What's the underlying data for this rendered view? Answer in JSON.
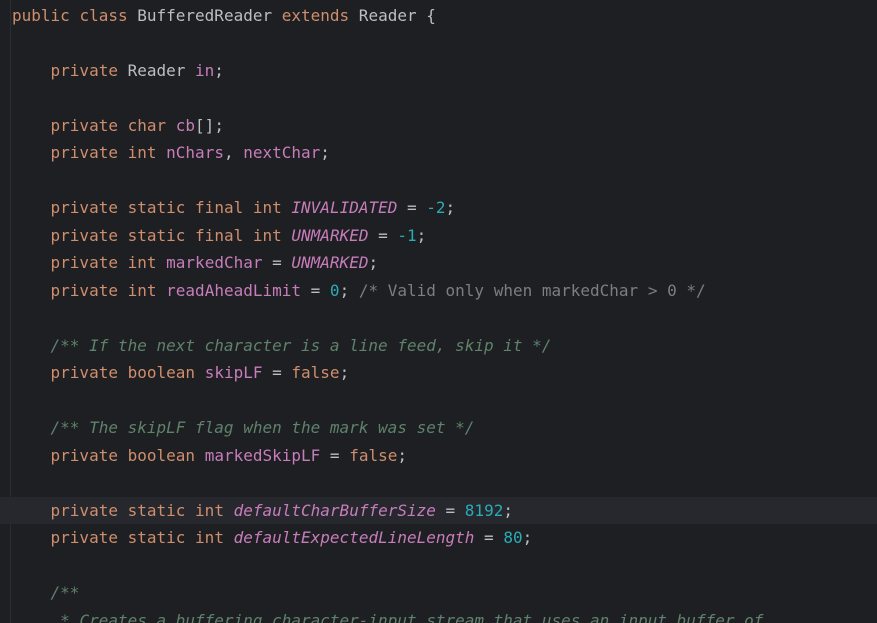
{
  "editor": {
    "language": "Java",
    "theme": "dark",
    "current_line_index": 18,
    "colors": {
      "background": "#1e1f22",
      "current_line": "#26282e",
      "keyword": "#cf8e6d",
      "identifier": "#bcbec4",
      "field": "#c77dbb",
      "number": "#2aacb8",
      "block_comment": "#7a7e85",
      "doc_comment": "#5f826b"
    },
    "lines": [
      [
        [
          "kw",
          "public"
        ],
        [
          "id",
          " "
        ],
        [
          "kw",
          "class"
        ],
        [
          "id",
          " BufferedReader "
        ],
        [
          "kw",
          "extends"
        ],
        [
          "id",
          " Reader {"
        ]
      ],
      [],
      [
        [
          "id",
          "    "
        ],
        [
          "kw",
          "private"
        ],
        [
          "id",
          " Reader "
        ],
        [
          "fld",
          "in"
        ],
        [
          "pun",
          ";"
        ]
      ],
      [],
      [
        [
          "id",
          "    "
        ],
        [
          "kw",
          "private"
        ],
        [
          "id",
          " "
        ],
        [
          "kw",
          "char"
        ],
        [
          "id",
          " "
        ],
        [
          "fld",
          "cb"
        ],
        [
          "pun",
          "[];"
        ]
      ],
      [
        [
          "id",
          "    "
        ],
        [
          "kw",
          "private"
        ],
        [
          "id",
          " "
        ],
        [
          "kw",
          "int"
        ],
        [
          "id",
          " "
        ],
        [
          "fld",
          "nChars"
        ],
        [
          "pun",
          ", "
        ],
        [
          "fld",
          "nextChar"
        ],
        [
          "pun",
          ";"
        ]
      ],
      [],
      [
        [
          "id",
          "    "
        ],
        [
          "kw",
          "private"
        ],
        [
          "id",
          " "
        ],
        [
          "kw",
          "static"
        ],
        [
          "id",
          " "
        ],
        [
          "kw",
          "final"
        ],
        [
          "id",
          " "
        ],
        [
          "kw",
          "int"
        ],
        [
          "id",
          " "
        ],
        [
          "cst",
          "INVALIDATED"
        ],
        [
          "pun",
          " = "
        ],
        [
          "num",
          "-2"
        ],
        [
          "pun",
          ";"
        ]
      ],
      [
        [
          "id",
          "    "
        ],
        [
          "kw",
          "private"
        ],
        [
          "id",
          " "
        ],
        [
          "kw",
          "static"
        ],
        [
          "id",
          " "
        ],
        [
          "kw",
          "final"
        ],
        [
          "id",
          " "
        ],
        [
          "kw",
          "int"
        ],
        [
          "id",
          " "
        ],
        [
          "cst",
          "UNMARKED"
        ],
        [
          "pun",
          " = "
        ],
        [
          "num",
          "-1"
        ],
        [
          "pun",
          ";"
        ]
      ],
      [
        [
          "id",
          "    "
        ],
        [
          "kw",
          "private"
        ],
        [
          "id",
          " "
        ],
        [
          "kw",
          "int"
        ],
        [
          "id",
          " "
        ],
        [
          "fld",
          "markedChar"
        ],
        [
          "pun",
          " = "
        ],
        [
          "cst",
          "UNMARKED"
        ],
        [
          "pun",
          ";"
        ]
      ],
      [
        [
          "id",
          "    "
        ],
        [
          "kw",
          "private"
        ],
        [
          "id",
          " "
        ],
        [
          "kw",
          "int"
        ],
        [
          "id",
          " "
        ],
        [
          "fld",
          "readAheadLimit"
        ],
        [
          "pun",
          " = "
        ],
        [
          "num",
          "0"
        ],
        [
          "pun",
          "; "
        ],
        [
          "blk",
          "/* Valid only when markedChar > 0 */"
        ]
      ],
      [],
      [
        [
          "id",
          "    "
        ],
        [
          "doc",
          "/** If the next character is a line feed, skip it */"
        ]
      ],
      [
        [
          "id",
          "    "
        ],
        [
          "kw",
          "private"
        ],
        [
          "id",
          " "
        ],
        [
          "kw",
          "boolean"
        ],
        [
          "id",
          " "
        ],
        [
          "fld",
          "skipLF"
        ],
        [
          "pun",
          " = "
        ],
        [
          "kw",
          "false"
        ],
        [
          "pun",
          ";"
        ]
      ],
      [],
      [
        [
          "id",
          "    "
        ],
        [
          "doc",
          "/** The skipLF flag when the mark was set */"
        ]
      ],
      [
        [
          "id",
          "    "
        ],
        [
          "kw",
          "private"
        ],
        [
          "id",
          " "
        ],
        [
          "kw",
          "boolean"
        ],
        [
          "id",
          " "
        ],
        [
          "fld",
          "markedSkipLF"
        ],
        [
          "pun",
          " = "
        ],
        [
          "kw",
          "false"
        ],
        [
          "pun",
          ";"
        ]
      ],
      [],
      [
        [
          "id",
          "    "
        ],
        [
          "kw",
          "private"
        ],
        [
          "id",
          " "
        ],
        [
          "kw",
          "static"
        ],
        [
          "id",
          " "
        ],
        [
          "kw",
          "int"
        ],
        [
          "id",
          " "
        ],
        [
          "cst",
          "defaultCharBufferSize"
        ],
        [
          "pun",
          " = "
        ],
        [
          "num",
          "8192"
        ],
        [
          "pun",
          ";"
        ]
      ],
      [
        [
          "id",
          "    "
        ],
        [
          "kw",
          "private"
        ],
        [
          "id",
          " "
        ],
        [
          "kw",
          "static"
        ],
        [
          "id",
          " "
        ],
        [
          "kw",
          "int"
        ],
        [
          "id",
          " "
        ],
        [
          "cst",
          "defaultExpectedLineLength"
        ],
        [
          "pun",
          " = "
        ],
        [
          "num",
          "80"
        ],
        [
          "pun",
          ";"
        ]
      ],
      [],
      [
        [
          "id",
          "    "
        ],
        [
          "doc",
          "/**"
        ]
      ],
      [
        [
          "id",
          "     "
        ],
        [
          "doc",
          "* Creates a buffering character-input stream that uses an input buffer of"
        ]
      ]
    ]
  }
}
